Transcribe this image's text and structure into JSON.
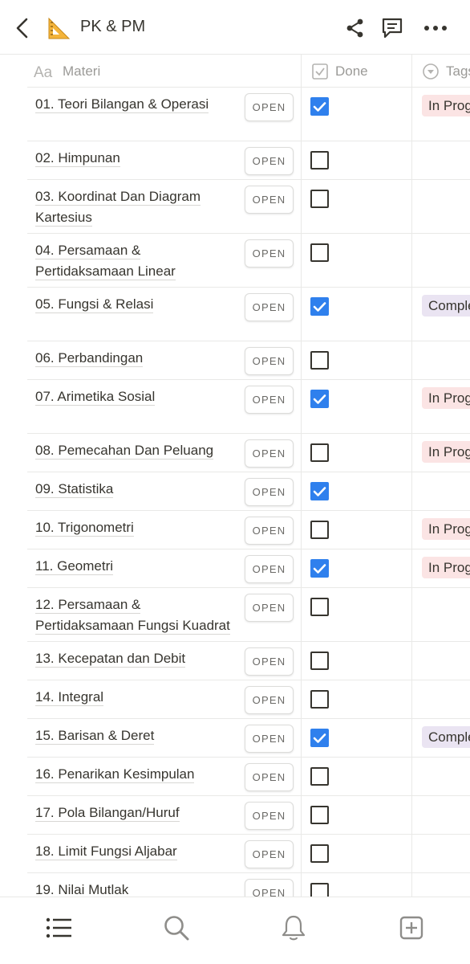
{
  "header": {
    "title": "PK & PM",
    "emoji_icon": "triangular-ruler-icon"
  },
  "columns": {
    "materi": "Materi",
    "done": "Done",
    "tags": "Tags"
  },
  "open_label": "OPEN",
  "tag_colors": {
    "In Progress": {
      "bg": "#fbe4e4",
      "fg": "#37352f"
    },
    "Completed": {
      "bg": "#eae4f2",
      "fg": "#37352f"
    }
  },
  "rows": [
    {
      "title": "01. Teori Bilangan & Operasi",
      "done": true,
      "tag": "In Progress"
    },
    {
      "title": "02. Himpunan",
      "done": false,
      "tag": ""
    },
    {
      "title": "03. Koordinat Dan Diagram Kartesius",
      "done": false,
      "tag": ""
    },
    {
      "title": "04. Persamaan & Pertidaksamaan Linear",
      "done": false,
      "tag": ""
    },
    {
      "title": "05. Fungsi & Relasi",
      "done": true,
      "tag": "Completed"
    },
    {
      "title": "06. Perbandingan",
      "done": false,
      "tag": ""
    },
    {
      "title": "07. Arimetika Sosial",
      "done": true,
      "tag": "In Progress"
    },
    {
      "title": "08. Pemecahan Dan Peluang",
      "done": false,
      "tag": "In Progress"
    },
    {
      "title": "09. Statistika",
      "done": true,
      "tag": ""
    },
    {
      "title": "10. Trigonometri",
      "done": false,
      "tag": "In Progress"
    },
    {
      "title": "11. Geometri",
      "done": true,
      "tag": "In Progress"
    },
    {
      "title": "12. Persamaan & Pertidaksamaan Fungsi Kuadrat",
      "done": false,
      "tag": ""
    },
    {
      "title": "13. Kecepatan dan Debit",
      "done": false,
      "tag": ""
    },
    {
      "title": "14. Integral",
      "done": false,
      "tag": ""
    },
    {
      "title": "15. Barisan & Deret",
      "done": true,
      "tag": "Completed"
    },
    {
      "title": "16. Penarikan Kesimpulan",
      "done": false,
      "tag": ""
    },
    {
      "title": "17. Pola Bilangan/Huruf",
      "done": false,
      "tag": ""
    },
    {
      "title": "18. Limit Fungsi Aljabar",
      "done": false,
      "tag": ""
    },
    {
      "title": "19. Nilai Mutlak",
      "done": false,
      "tag": ""
    }
  ],
  "bottom_nav": [
    "list-icon",
    "search-icon",
    "bell-icon",
    "new-page-icon"
  ]
}
